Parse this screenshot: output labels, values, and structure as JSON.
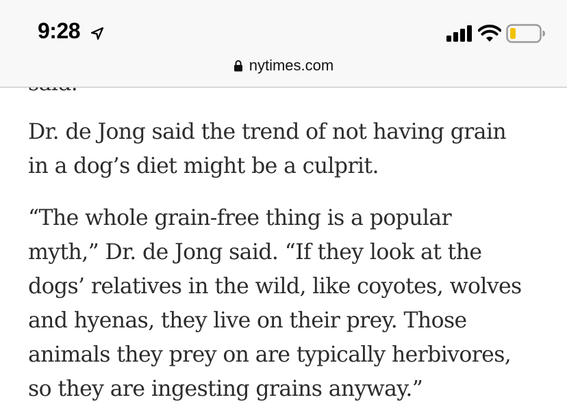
{
  "status_bar": {
    "time": "9:28",
    "icons": [
      "location-arrow-icon",
      "cellular-signal-icon",
      "wifi-icon",
      "battery-low-icon"
    ],
    "battery_color": "#f2c200"
  },
  "browser": {
    "url": "nytimes.com",
    "lock_icon": "lock-icon"
  },
  "article": {
    "partial_line": "said.",
    "paragraphs": [
      [
        "Dr. de Jong said the trend of not having grain",
        "in a dog’s diet might be a culprit."
      ],
      [
        "“The whole grain-free thing is a popular",
        "myth,” Dr. de Jong said. “If they look at the",
        "dogs’ relatives in the wild, like coyotes, wolves",
        "and hyenas, they live on their prey. Those",
        "animals they prey on are typically herbivores,",
        "so they are ingesting grains anyway.”"
      ]
    ]
  }
}
